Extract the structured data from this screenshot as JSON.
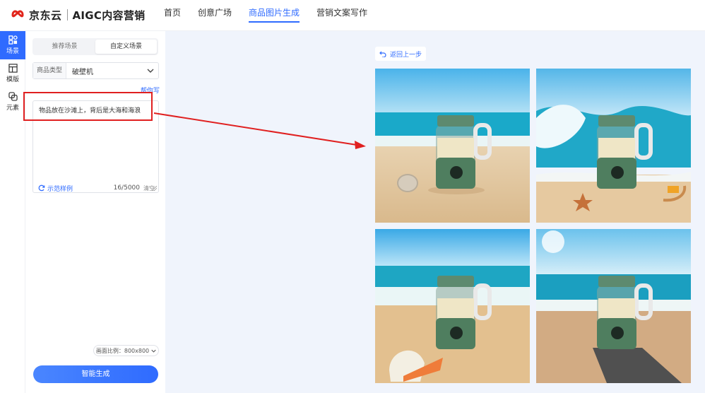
{
  "header": {
    "brand": "京东云",
    "product": "AIGC内容营销",
    "nav": [
      "首页",
      "创意广场",
      "商品图片生成",
      "营销文案写作"
    ],
    "active_nav": "商品图片生成"
  },
  "rail": {
    "items": [
      {
        "label": "场景",
        "icon": "scene-icon",
        "active": true
      },
      {
        "label": "模版",
        "icon": "template-icon",
        "active": false
      },
      {
        "label": "元素",
        "icon": "element-icon",
        "active": false
      }
    ]
  },
  "panel": {
    "tabs": [
      "推荐场景",
      "自定义场景"
    ],
    "active_tab": "自定义场景",
    "type_label": "商品类型",
    "type_value": "破壁机",
    "helper": "帮你写",
    "prompt": "物品放在沙滩上，背后是大海和海浪",
    "example": "示范样例",
    "count": "16/5000",
    "clear": "清空",
    "ratio": "画面比例：800x800",
    "generate": "智能生成"
  },
  "main": {
    "back": "返回上一步",
    "images": [
      "beach-blender-1",
      "beach-blender-2",
      "beach-blender-3",
      "beach-blender-4"
    ]
  },
  "colors": {
    "accent": "#2f6bff",
    "annotation": "#e02020"
  }
}
